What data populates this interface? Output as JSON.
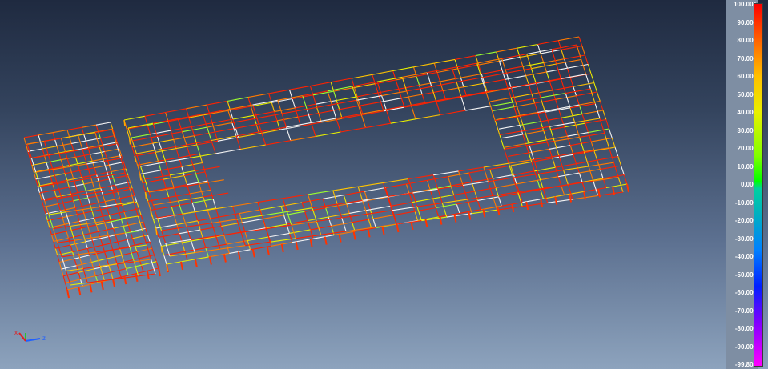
{
  "viewport": {
    "background_top": "#1f2a40",
    "background_bottom": "#8da3bd",
    "member_colors": [
      "#ff2200",
      "#ff7a00",
      "#ffc400",
      "#e8f000",
      "#9cff30",
      "#f4f4f4"
    ]
  },
  "color_scale": {
    "max_value": 100.001,
    "min_value": -99.803,
    "ticks": [
      "100.001",
      "90.000",
      "80.000",
      "70.000",
      "60.000",
      "50.000",
      "40.000",
      "30.000",
      "20.000",
      "10.000",
      "0.000",
      "-10.000",
      "-20.000",
      "-30.000",
      "-40.000",
      "-50.000",
      "-60.000",
      "-70.000",
      "-80.000",
      "-90.000",
      "-99.803"
    ]
  },
  "axis_triad": {
    "x_label": "x",
    "z_label": "z",
    "x_color": "#e02020",
    "y_color": "#30c030",
    "z_color": "#2060ff"
  }
}
